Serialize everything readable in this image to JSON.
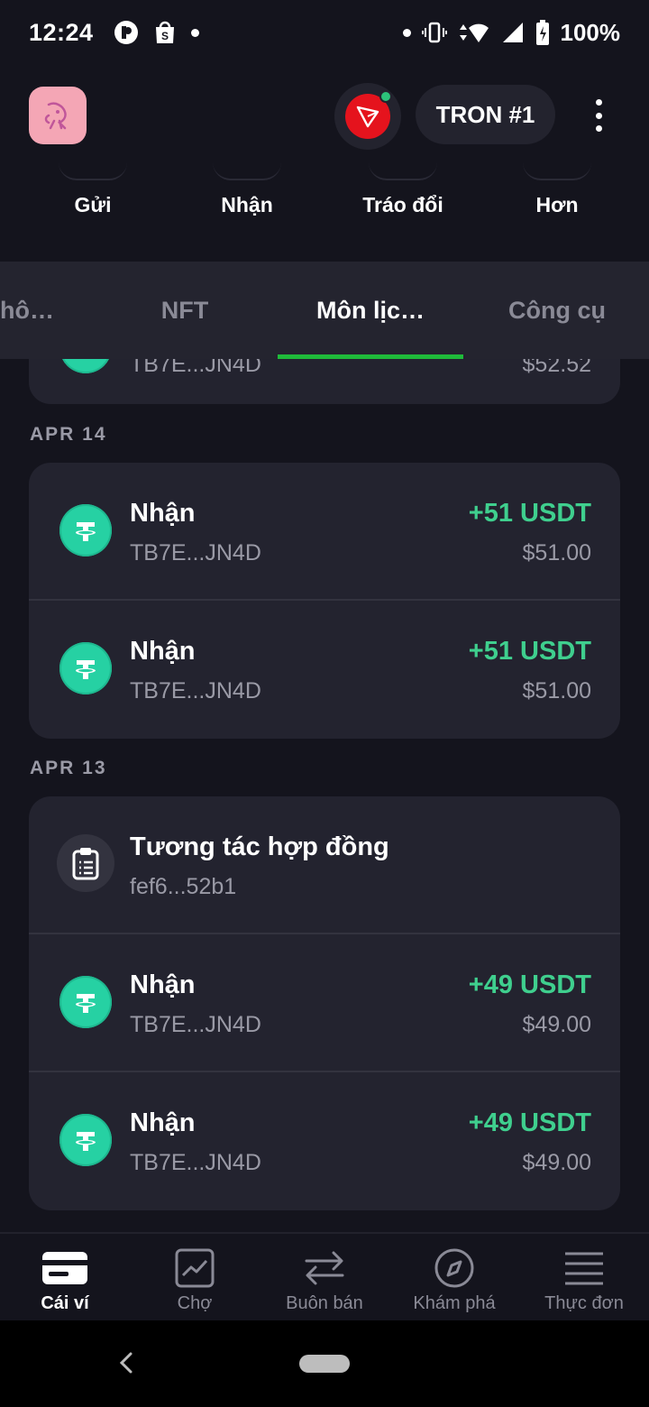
{
  "status_bar": {
    "time": "12:24",
    "battery": "100%"
  },
  "header": {
    "wallet_name": "TRON #1"
  },
  "actions": [
    {
      "label": "Gửi"
    },
    {
      "label": "Nhận"
    },
    {
      "label": "Tráo đổi"
    },
    {
      "label": "Hơn"
    }
  ],
  "tabs": [
    {
      "label": "hô…",
      "active": false
    },
    {
      "label": "NFT",
      "active": false
    },
    {
      "label": "Môn lịc…",
      "active": true
    },
    {
      "label": "Công cụ",
      "active": false
    }
  ],
  "history": {
    "partial_row": {
      "sub": "TB7E...JN4D",
      "fiat": "$52.52"
    },
    "groups": [
      {
        "date": "APR 14",
        "items": [
          {
            "icon": "tether-icon",
            "title": "Nhận",
            "sub": "TB7E...JN4D",
            "amount": "+51 USDT",
            "fiat": "$51.00"
          },
          {
            "icon": "tether-icon",
            "title": "Nhận",
            "sub": "TB7E...JN4D",
            "amount": "+51 USDT",
            "fiat": "$51.00"
          }
        ]
      },
      {
        "date": "APR 13",
        "items": [
          {
            "icon": "contract-icon",
            "title": "Tương tác hợp đồng",
            "sub": "fef6...52b1",
            "amount": "",
            "fiat": ""
          },
          {
            "icon": "tether-icon",
            "title": "Nhận",
            "sub": "TB7E...JN4D",
            "amount": "+49 USDT",
            "fiat": "$49.00"
          },
          {
            "icon": "tether-icon",
            "title": "Nhận",
            "sub": "TB7E...JN4D",
            "amount": "+49 USDT",
            "fiat": "$49.00"
          }
        ]
      }
    ]
  },
  "bottom_nav": [
    {
      "label": "Cái ví",
      "icon": "wallet-icon",
      "active": true
    },
    {
      "label": "Chợ",
      "icon": "market-chart-icon",
      "active": false
    },
    {
      "label": "Buôn bán",
      "icon": "swap-arrows-icon",
      "active": false
    },
    {
      "label": "Khám phá",
      "icon": "compass-icon",
      "active": false
    },
    {
      "label": "Thực đơn",
      "icon": "menu-icon",
      "active": false
    }
  ],
  "colors": {
    "background": "#14141d",
    "card": "#23232f",
    "accent_green": "#3fcf8e",
    "tab_underline": "#1fbb3a",
    "tron_red": "#e5131d",
    "tether_teal": "#26d1a3"
  }
}
